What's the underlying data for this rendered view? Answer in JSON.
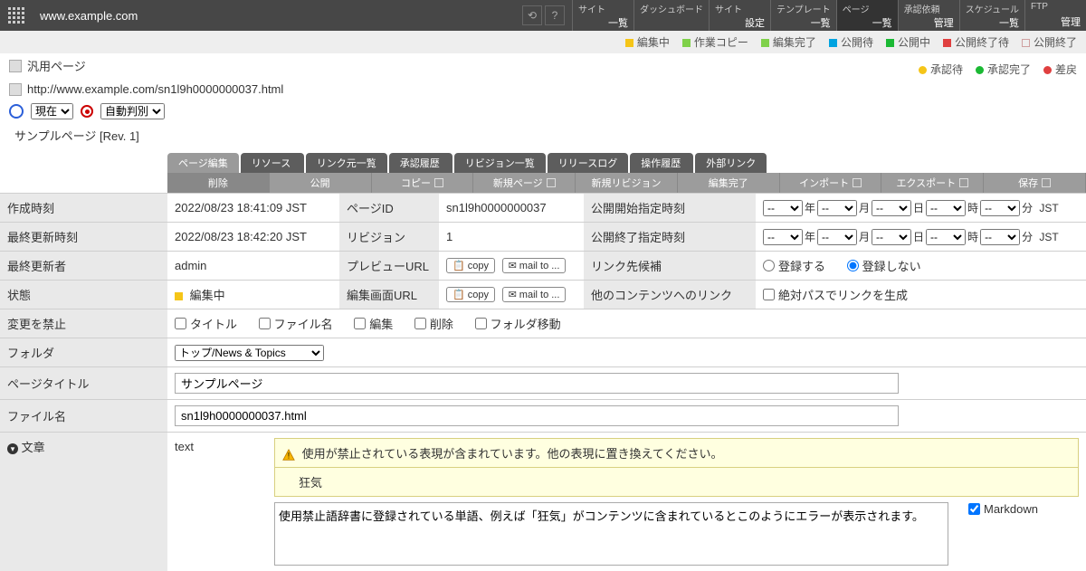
{
  "top": {
    "url": "www.example.com",
    "nav": [
      {
        "t": "サイト",
        "b": "一覧"
      },
      {
        "t": "ダッシュボード",
        "b": ""
      },
      {
        "t": "サイト",
        "b": "設定"
      },
      {
        "t": "テンプレート",
        "b": "一覧"
      },
      {
        "t": "ページ",
        "b": "一覧"
      },
      {
        "t": "承認依頼",
        "b": "管理"
      },
      {
        "t": "スケジュール",
        "b": "一覧"
      },
      {
        "t": "FTP",
        "b": "管理"
      }
    ]
  },
  "status1": [
    {
      "c": "#f5c518",
      "l": "編集中",
      "shape": "sq"
    },
    {
      "c": "#7fd14a",
      "l": "作業コピー",
      "shape": "sq"
    },
    {
      "c": "#7fd14a",
      "l": "編集完了",
      "shape": "sq"
    },
    {
      "c": "#00a3e0",
      "l": "公開待",
      "shape": "sq"
    },
    {
      "c": "#1bb934",
      "l": "公開中",
      "shape": "sq"
    },
    {
      "c": "#e04040",
      "l": "公開終了待",
      "shape": "sq"
    },
    {
      "c": "#cfa0a0",
      "l": "公開終了",
      "shape": "sq"
    }
  ],
  "status2": [
    {
      "c": "#f5c518",
      "l": "承認待",
      "shape": "circ"
    },
    {
      "c": "#1bb934",
      "l": "承認完了",
      "shape": "circ"
    },
    {
      "c": "#e04040",
      "l": "差戻",
      "shape": "circ"
    }
  ],
  "bc": {
    "pagetype": "汎用ページ",
    "fullurl": "http://www.example.com/sn1l9h0000000037.html",
    "now": "現在",
    "auto": "自動判別",
    "revline": "サンプルページ [Rev. 1]"
  },
  "tabs": [
    "ページ編集",
    "リソース",
    "リンク元一覧",
    "承認履歴",
    "リビジョン一覧",
    "リリースログ",
    "操作履歴",
    "外部リンク"
  ],
  "toolbar": [
    "削除",
    "公開",
    "コピー",
    "新規ページ",
    "新規リビジョン",
    "編集完了",
    "インポート",
    "エクスポート",
    "保存"
  ],
  "grid": {
    "created_l": "作成時刻",
    "created": "2022/08/23 18:41:09 JST",
    "pageid_l": "ページID",
    "pageid": "sn1l9h0000000037",
    "pubstart_l": "公開開始指定時刻",
    "updated_l": "最終更新時刻",
    "updated": "2022/08/23 18:42:20 JST",
    "rev_l": "リビジョン",
    "rev": "1",
    "pubend_l": "公開終了指定時刻",
    "updater_l": "最終更新者",
    "updater": "admin",
    "preview_l": "プレビューURL",
    "copy": "copy",
    "mailto": "mail to ...",
    "linkcand_l": "リンク先候補",
    "reg_yes": "登録する",
    "reg_no": "登録しない",
    "state_l": "状態",
    "state": "編集中",
    "editurl_l": "編集画面URL",
    "otherlink_l": "他のコンテンツへのリンク",
    "abs": "絶対パスでリンクを生成",
    "deny_l": "変更を禁止",
    "cb_title": "タイトル",
    "cb_file": "ファイル名",
    "cb_edit": "編集",
    "cb_del": "削除",
    "cb_folder": "フォルダ移動",
    "folder_l": "フォルダ",
    "folder_v": "トップ/News & Topics",
    "title_l": "ページタイトル",
    "title_v": "サンプルページ",
    "filename_l": "ファイル名",
    "filename_v": "sn1l9h0000000037.html",
    "body_l": "文章",
    "body_name": "text",
    "warn": "使用が禁止されている表現が含まれています。他の表現に置き換えてください。",
    "warn_word": "狂気",
    "body_v": "使用禁止語辞書に登録されている単語、例えば「狂気」がコンテンツに含まれているとこのようにエラーが表示されます。",
    "markdown": "Markdown",
    "dt": {
      "y": "年",
      "m": "月",
      "d": "日",
      "h": "時",
      "mi": "分",
      "tz": "JST",
      "dash": "--"
    }
  }
}
